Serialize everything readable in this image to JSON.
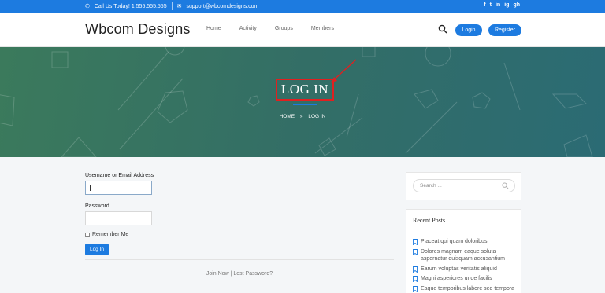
{
  "topbar": {
    "phone": "Call Us Today! 1.555.555.555",
    "email": "support@wbcomdesigns.com",
    "social": [
      "f",
      "t",
      "in",
      "ig",
      "gh"
    ]
  },
  "header": {
    "brand": "Wbcom Designs",
    "nav": [
      "Home",
      "Activity",
      "Groups",
      "Members"
    ],
    "login": "Login",
    "register": "Register"
  },
  "hero": {
    "title": "LOG IN",
    "breadcrumb": {
      "home": "HOME",
      "sep": "»",
      "current": "LOG IN"
    }
  },
  "form": {
    "username_label": "Username or Email Address",
    "username_value": "",
    "password_label": "Password",
    "password_value": "",
    "remember_label": "Remember Me",
    "submit_label": "Log In"
  },
  "links": {
    "join": "Join Now",
    "sep": "|",
    "lost": "Lost Password?"
  },
  "sidebar": {
    "search_placeholder": "Search ...",
    "recent_title": "Recent Posts",
    "posts": [
      "Placeat qui quam doloribus",
      "Dolores magnam eaque soluta aspernatur quisquam accusantium",
      "Earum voluptas veritatis aliquid",
      "Magni asperiores unde facilis",
      "Eaque temporibus labore sed tempora"
    ]
  },
  "colors": {
    "accent": "#1d7be0",
    "highlight": "#e02020"
  }
}
